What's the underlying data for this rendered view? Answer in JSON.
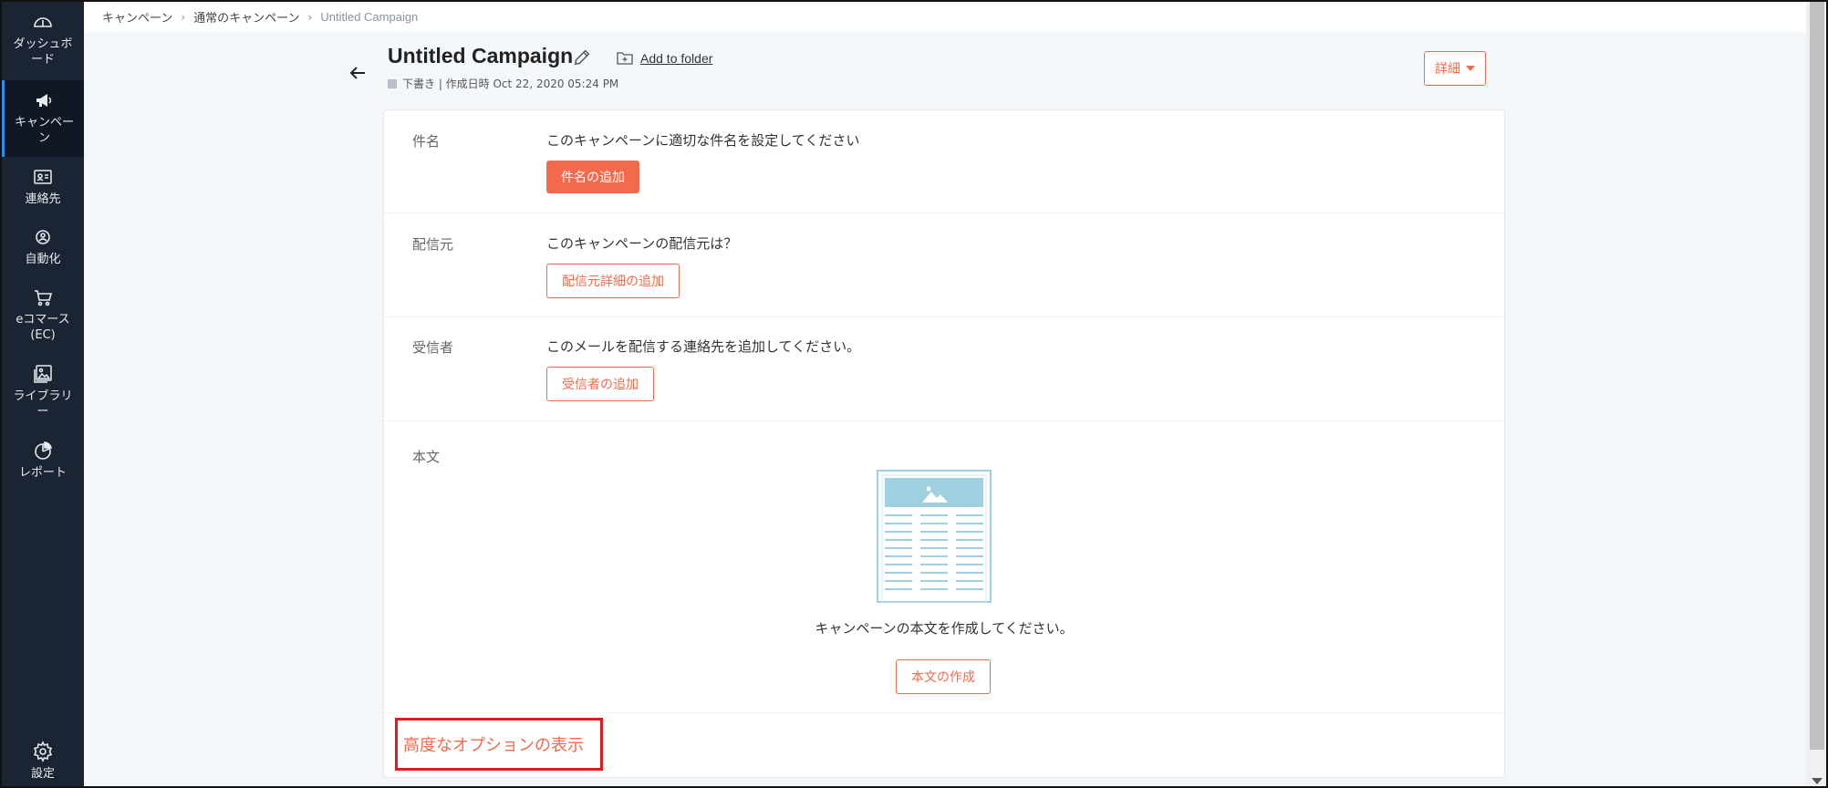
{
  "sidebar": {
    "items": [
      {
        "label": "ダッシュボード",
        "icon": "dashboard-icon"
      },
      {
        "label": "キャンペーン",
        "icon": "megaphone-icon",
        "active": true
      },
      {
        "label": "連絡先",
        "icon": "contact-card-icon"
      },
      {
        "label": "自動化",
        "icon": "automation-icon"
      },
      {
        "label": "eコマース(EC)",
        "icon": "cart-icon"
      },
      {
        "label": "ライブラリー",
        "icon": "image-library-icon"
      },
      {
        "label": "レポート",
        "icon": "pie-chart-icon"
      }
    ],
    "settings": {
      "label": "設定",
      "icon": "gear-icon"
    }
  },
  "breadcrumb": {
    "items": [
      "キャンペーン",
      "通常のキャンペーン"
    ],
    "separator": "›",
    "current": "Untitled Campaign"
  },
  "header": {
    "title": "Untitled Campaign",
    "add_to_folder": "Add to folder",
    "status_line": "下書き | 作成日時 Oct 22, 2020 05:24 PM",
    "detail_button": "詳細"
  },
  "sections": {
    "subject": {
      "label": "件名",
      "description": "このキャンペーンに適切な件名を設定してください",
      "button": "件名の追加"
    },
    "sender": {
      "label": "配信元",
      "description": "このキャンペーンの配信元は？",
      "button": "配信元詳細の追加"
    },
    "recipients": {
      "label": "受信者",
      "description": "このメールを配信する連絡先を追加してください。",
      "button": "受信者の追加"
    },
    "body": {
      "label": "本文",
      "description": "キャンペーンの本文を作成してください。",
      "button": "本文の作成"
    }
  },
  "advanced_options_link": "高度なオプションの表示",
  "colors": {
    "accent": "#f26a4b",
    "sidebar_bg": "#1b2432",
    "highlight_border": "#e01b1b",
    "illustration": "#9fd0e0"
  }
}
